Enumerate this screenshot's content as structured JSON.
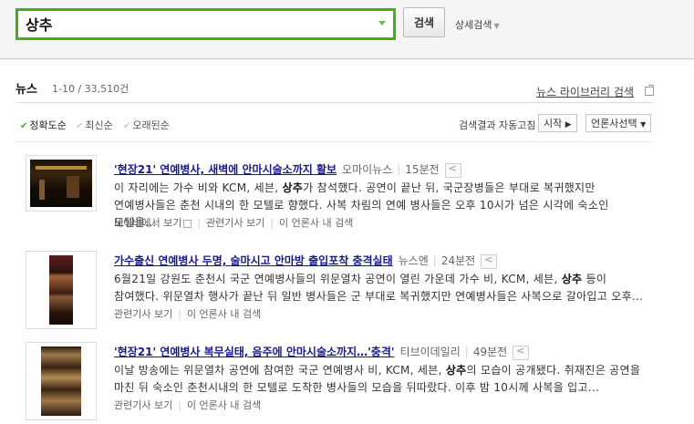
{
  "search": {
    "query": "상추",
    "button_label": "검색",
    "advanced_label": "상세검색"
  },
  "section": {
    "title": "뉴스",
    "count": "1-10 / 33,510건",
    "library_link": "뉴스 라이브러리 검색"
  },
  "sort": {
    "options": [
      "정확도순",
      "최신순",
      "오래된순"
    ],
    "active_index": 0,
    "autocorrect_label": "검색결과 자동고침",
    "start_label": "시작",
    "press_select_label": "언론사선택"
  },
  "results": [
    {
      "title": "'현장21' 연예병사, 새벽에 안마시술소까지 활보",
      "source": "오마이뉴스",
      "time": "15분전",
      "snippet_pre": "이 자리에는 가수 비와 KCM, 세븐, ",
      "snippet_bold": "상추",
      "snippet_post": "가 참석했다. 공연이 끝난 뒤, 국군장병들은 부대로 복귀했지만 연예병사들은 춘천 시내의 한 모텔로 향했다. 사복 차림의 연예 병사들은 오후 10시가 넘은 시각에 숙소인 모텔을...",
      "links": [
        "네이버에서 보기",
        "관련기사 보기",
        "이 언론사 내 검색"
      ]
    },
    {
      "title": "가수출신 연예병사 두명, 술마시고 안마방 출입포착 충격실태",
      "source": "뉴스엔",
      "time": "24분전",
      "snippet_pre": "6월21일 강원도 춘천시 국군 연예병사들의 위문열차 공연이 열린 가운데 가수 비, KCM, 세븐, ",
      "snippet_bold": "상추",
      "snippet_post": " 등이 참여했다. 위문열차 행사가 끝난 뒤 일반 병사들은 군 부대로 복귀했지만 연예병사들은 사복으로 갈아입고 오후...",
      "links": [
        "관련기사 보기",
        "이 언론사 내 검색"
      ]
    },
    {
      "title": "'현장21' 연예병사 복무실태, 음주에 안마시술소까지…'충격'",
      "source": "티브이데일리",
      "time": "49분전",
      "snippet_pre": "이날 방송에는 위문열차 공연에 참여한 국군 연예병사 비, KCM, 세븐, ",
      "snippet_bold": "상추",
      "snippet_post": "의 모습이 공개됐다. 취재진은 공연을 마친 뒤 숙소인 춘천시내의 한 모텔로 도착한 병사들의 모습을 뒤따랐다. 이후 밤 10시께 사복을 입고...",
      "links": [
        "관련기사 보기",
        "이 언론사 내 검색"
      ]
    }
  ],
  "colors": {
    "search_border": "#3fb21a",
    "link": "#1a1a8c"
  }
}
